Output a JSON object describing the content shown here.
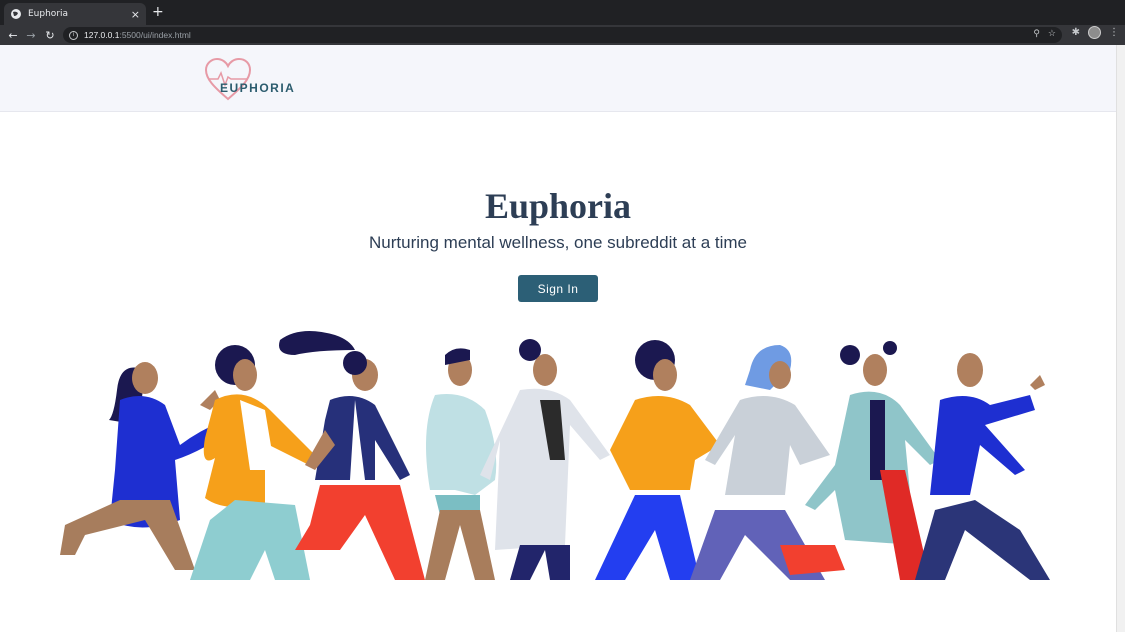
{
  "browser": {
    "tab_title": "Euphoria",
    "tab_close": "×",
    "new_tab": "+",
    "url_host": "127.0.0.1",
    "url_rest": ":5500/ui/index.html"
  },
  "header": {
    "logo_text": "EUPHORIA"
  },
  "hero": {
    "title": "Euphoria",
    "subtitle": "Nurturing mental wellness, one subreddit at a time",
    "signin_label": "Sign In"
  },
  "colors": {
    "button": "#2c5f76",
    "heading": "#2d3e55",
    "header_bg": "#f5f6fb"
  }
}
